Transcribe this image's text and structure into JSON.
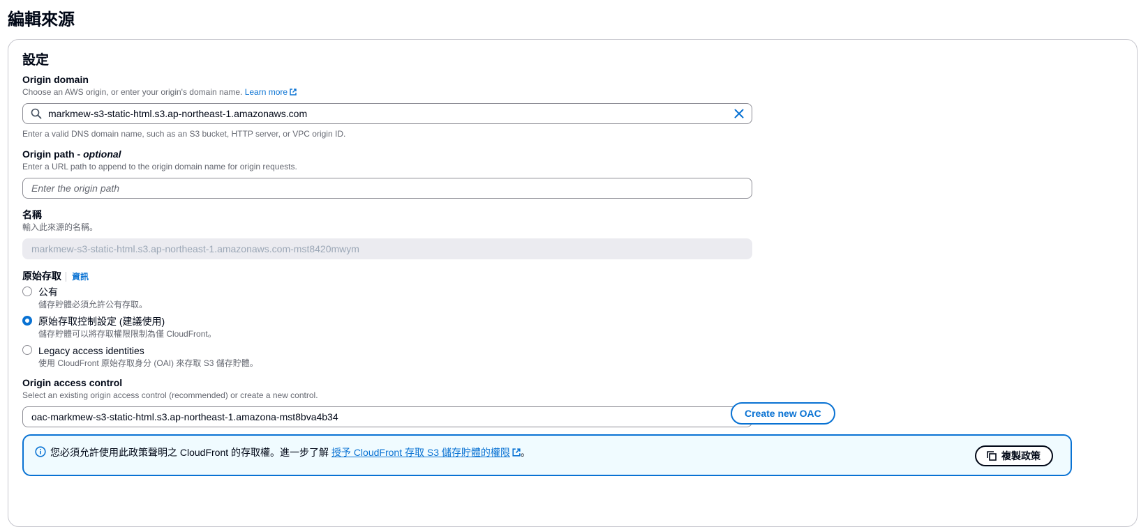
{
  "page": {
    "title": "編輯來源"
  },
  "settings": {
    "title": "設定",
    "origin_domain": {
      "label": "Origin domain",
      "description": "Choose an AWS origin, or enter your origin's domain name.",
      "learn_more": "Learn more",
      "value": "markmew-s3-static-html.s3.ap-northeast-1.amazonaws.com",
      "hint": "Enter a valid DNS domain name, such as an S3 bucket, HTTP server, or VPC origin ID."
    },
    "origin_path": {
      "label": "Origin path - ",
      "label_optional": "optional",
      "description": "Enter a URL path to append to the origin domain name for origin requests.",
      "placeholder": "Enter the origin path"
    },
    "name": {
      "label": "名稱",
      "description": "輸入此來源的名稱。",
      "value": "markmew-s3-static-html.s3.ap-northeast-1.amazonaws.com-mst8420mwym"
    },
    "origin_access": {
      "label": "原始存取",
      "info_link": "資訊",
      "options": [
        {
          "label": "公有",
          "description": "儲存貯體必須允許公有存取。",
          "checked": false
        },
        {
          "label": "原始存取控制設定 (建議使用)",
          "description": "儲存貯體可以將存取權限限制為僅 CloudFront。",
          "checked": true
        },
        {
          "label": "Legacy access identities",
          "description": "使用 CloudFront 原始存取身分 (OAI) 來存取 S3 儲存貯體。",
          "checked": false
        }
      ]
    },
    "origin_access_control": {
      "label": "Origin access control",
      "description": "Select an existing origin access control (recommended) or create a new control.",
      "selected": "oac-markmew-s3-static-html.s3.ap-northeast-1.amazona-mst8bva4b34",
      "create_button": "Create new OAC"
    },
    "alert": {
      "text": "您必須允許使用此政策聲明之 CloudFront 的存取權。進一步了解",
      "link": "授予 CloudFront 存取 S3 儲存貯體的權限",
      "suffix": "。",
      "copy_button": "複製政策"
    }
  },
  "colors": {
    "accent": "#0972d3",
    "alert_bg": "#f0fbff",
    "text": "#000716",
    "muted": "#656871"
  }
}
